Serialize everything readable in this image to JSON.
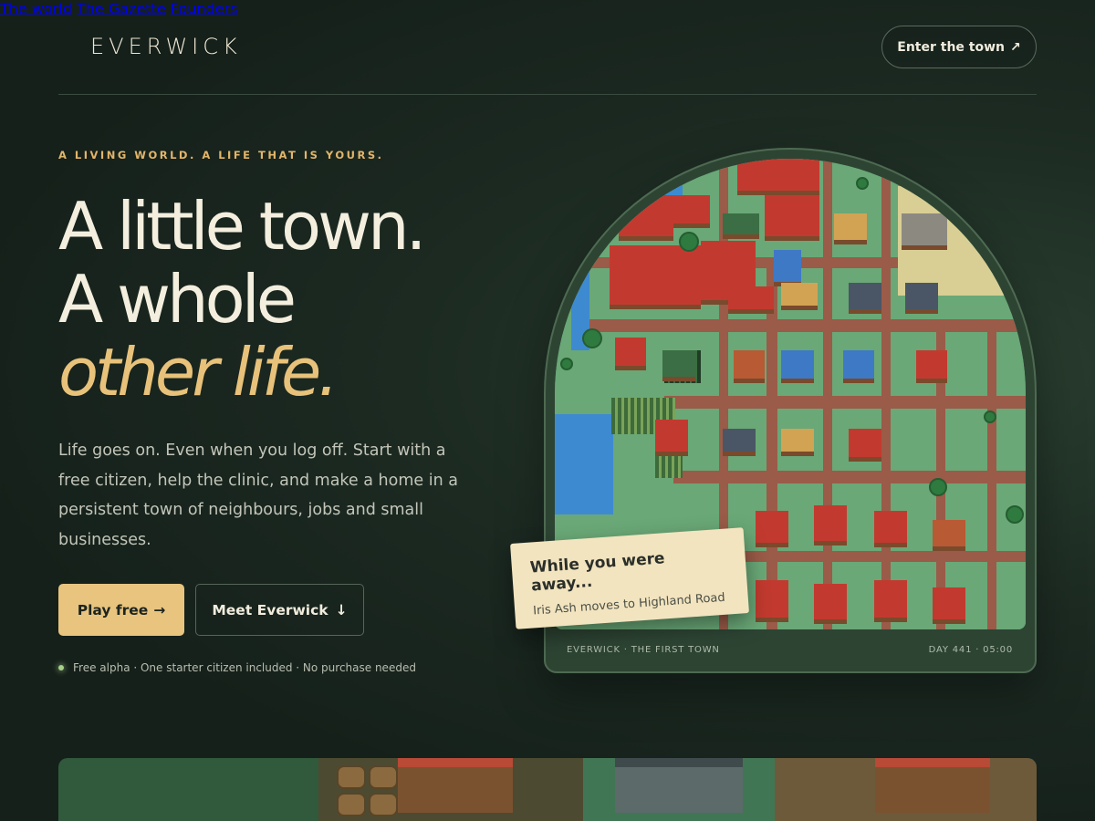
{
  "header": {
    "logo": "EVERWICK",
    "nav": [
      "The world",
      "The Gazette",
      "Founders"
    ],
    "cta_label": "Enter the town",
    "cta_icon": "arrow-up-right-icon"
  },
  "hero": {
    "eyebrow": "A LIVING WORLD. A LIFE THAT IS YOURS.",
    "headline_line1": "A little town.",
    "headline_line2": "A whole",
    "headline_line3": "other life.",
    "lede": "Life goes on. Even when you log off. Start with a free citizen, help the clinic, and make a home in a persistent town of neighbours, jobs and small businesses.",
    "primary_button": "Play free",
    "primary_icon": "arrow-right-icon",
    "secondary_button": "Meet Everwick",
    "secondary_icon": "arrow-down-icon",
    "footnote": "Free alpha · One starter citizen included · No purchase needed"
  },
  "map_card": {
    "caption_left": "EVERWICK · THE FIRST TOWN",
    "caption_right": "DAY 441 · 05:00",
    "note_title": "While you were away...",
    "note_body": "Iris Ash moves to Highland Road"
  },
  "colors": {
    "accent": "#e8c27a",
    "background": "#1c2a22",
    "status_dot": "#a7d08a"
  }
}
